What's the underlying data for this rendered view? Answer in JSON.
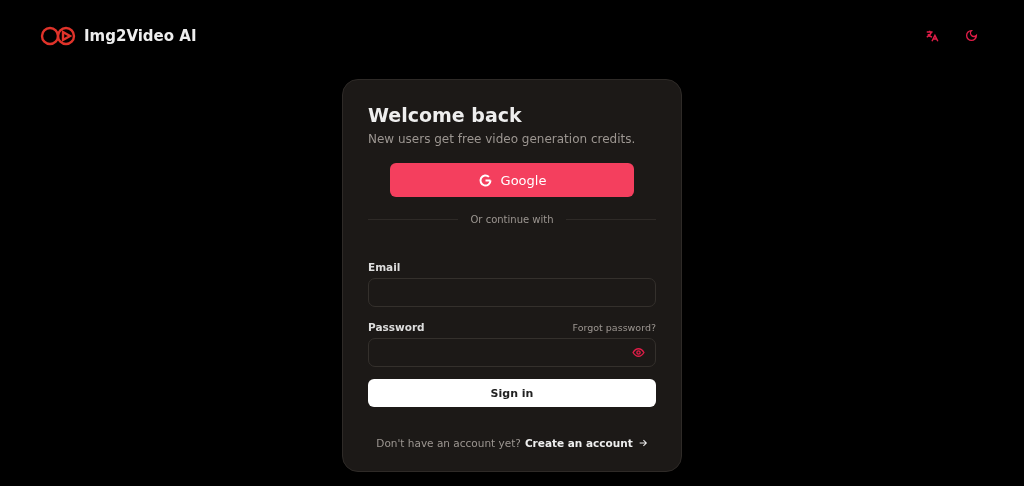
{
  "header": {
    "brand": "Img2Video AI"
  },
  "card": {
    "title": "Welcome back",
    "subtitle": "New users get free video generation credits.",
    "google_button": "Google",
    "divider": "Or continue with",
    "fields": [
      {
        "label": "Email",
        "kind": "text"
      },
      {
        "label": "Password",
        "kind": "password",
        "link": "Forgot password?"
      }
    ],
    "submit": "Sign in",
    "footer": {
      "text": "Don't have an account yet?",
      "link": "Create an account"
    }
  }
}
